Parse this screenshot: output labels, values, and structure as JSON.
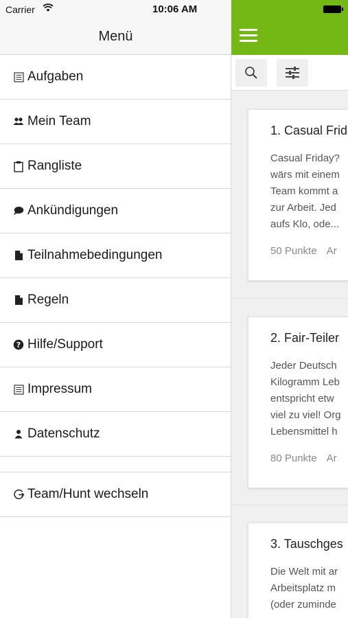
{
  "status": {
    "carrier": "Carrier",
    "time": "10:06 AM"
  },
  "drawer": {
    "title": "Menü",
    "items": [
      {
        "label": "Aufgaben",
        "icon": "list-icon"
      },
      {
        "label": "Mein Team",
        "icon": "team-icon"
      },
      {
        "label": "Rangliste",
        "icon": "clipboard-icon"
      },
      {
        "label": "Ankündigungen",
        "icon": "speech-bubble-icon"
      },
      {
        "label": "Teilnahmebedingungen",
        "icon": "document-icon"
      },
      {
        "label": "Regeln",
        "icon": "document-icon"
      },
      {
        "label": "Hilfe/Support",
        "icon": "help-icon"
      },
      {
        "label": "Impressum",
        "icon": "list-icon"
      },
      {
        "label": "Datenschutz",
        "icon": "person-icon"
      }
    ],
    "switch_item": {
      "label": "Team/Hunt wechseln",
      "icon": "switch-icon"
    }
  },
  "main": {
    "accent": "#74b816",
    "cards": [
      {
        "title": "1. Casual Frid",
        "body": "Casual Friday?\nwärs mit einem\nTeam kommt a\nzur Arbeit. Jed\naufs Klo, ode...",
        "points": "50 Punkte",
        "extra": "Ar"
      },
      {
        "title": "2. Fair-Teiler",
        "body": "Jeder Deutsch\nKilogramm Leb\nentspricht etw\nviel zu viel! Org\nLebensmittel h",
        "points": "80 Punkte",
        "extra": "Ar"
      },
      {
        "title": "3. Tauschges",
        "body": "Die Welt mit ar\nArbeitsplatz m\n(oder zuminde",
        "points": "",
        "extra": ""
      }
    ]
  }
}
